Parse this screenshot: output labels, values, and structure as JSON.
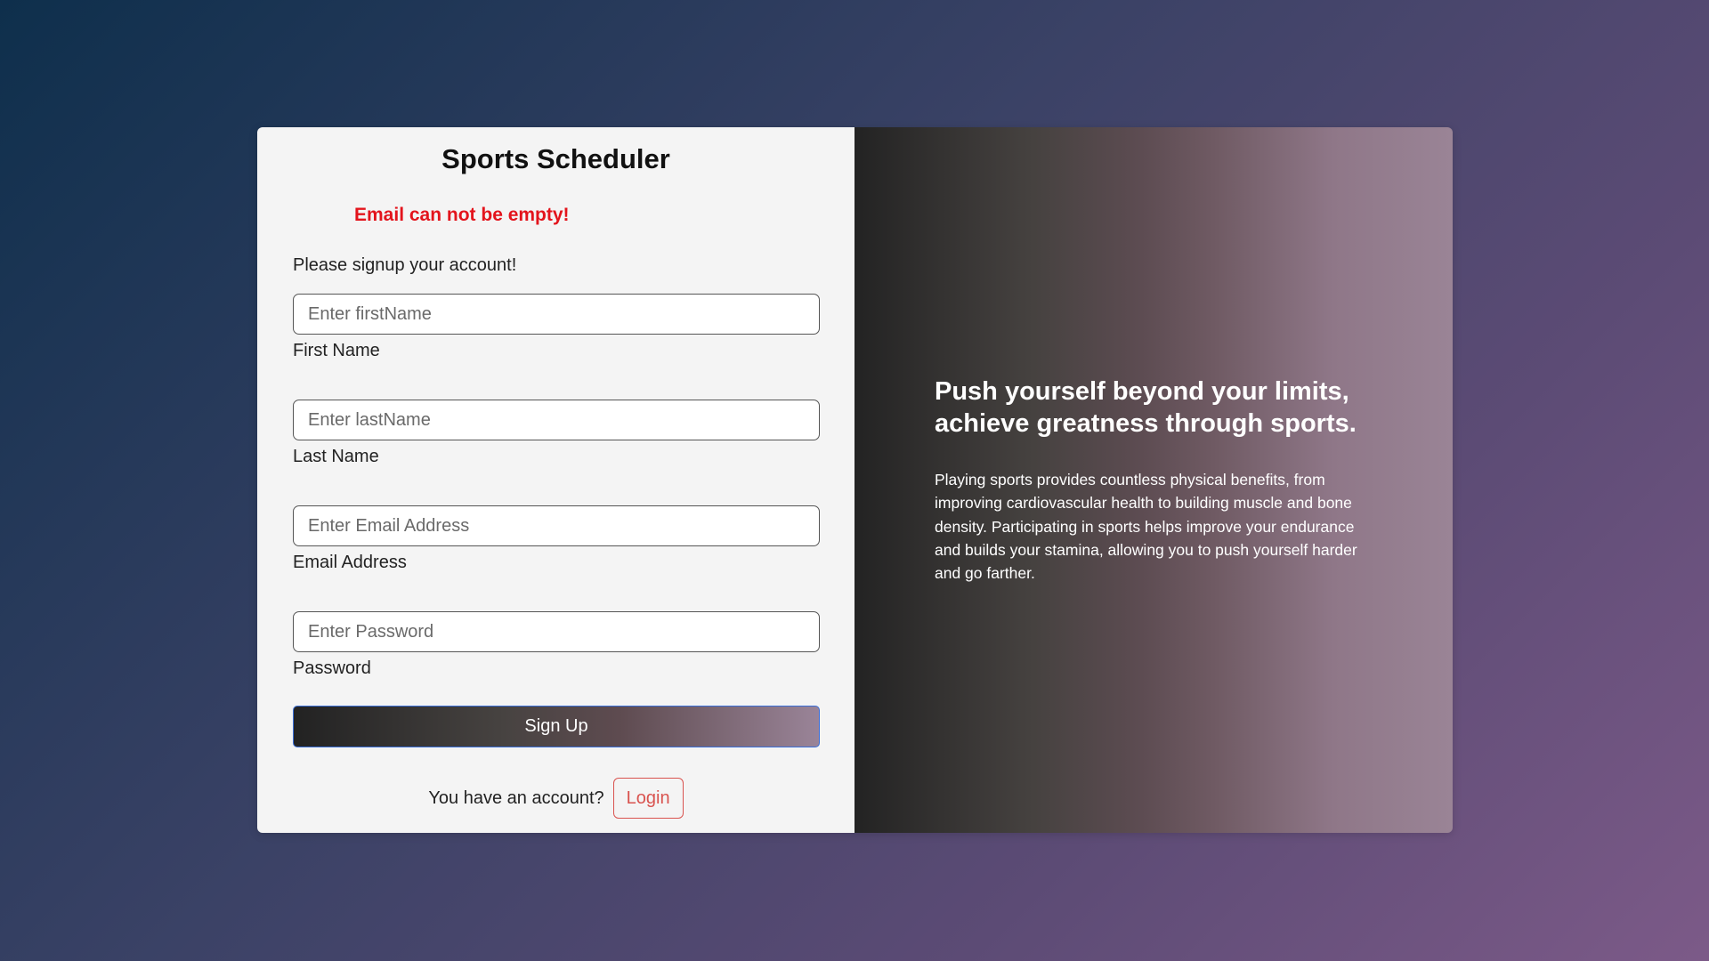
{
  "app": {
    "title": "Sports Scheduler"
  },
  "form": {
    "error": "Email can not be empty!",
    "intro": "Please signup your account!",
    "fields": [
      {
        "placeholder": "Enter firstName",
        "label": "First Name"
      },
      {
        "placeholder": "Enter lastName",
        "label": "Last Name"
      },
      {
        "placeholder": "Enter Email Address",
        "label": "Email Address"
      },
      {
        "placeholder": "Enter Password",
        "label": "Password"
      }
    ],
    "signup_label": "Sign Up",
    "account_prompt": "You have an account?",
    "login_label": "Login"
  },
  "promo": {
    "heading": "Push yourself beyond your limits, achieve greatness through sports.",
    "body": "Playing sports provides countless physical benefits, from improving cardiovascular health to building muscle and bone density. Participating in sports helps improve your endurance and builds your stamina, allowing you to push yourself harder and go farther."
  },
  "colors": {
    "error": "#e3141c",
    "login_accent": "#d9534f",
    "signup_border": "#3a6fd8"
  }
}
